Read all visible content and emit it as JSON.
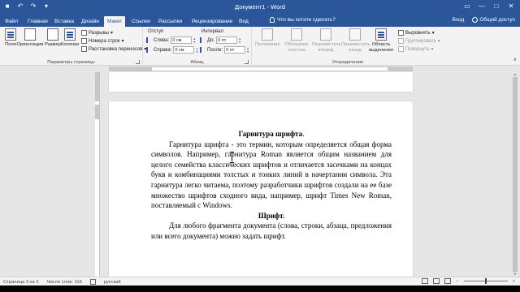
{
  "titlebar": {
    "doc_title": "Документ1 - Word",
    "qat": [
      "save-icon",
      "undo-icon",
      "redo-icon",
      "customize-icon"
    ],
    "controls": [
      "ribbon-display-icon",
      "minimize-icon",
      "maximize-icon",
      "close-icon"
    ]
  },
  "tabs": [
    {
      "label": "Файл",
      "active": false
    },
    {
      "label": "Главная",
      "active": false
    },
    {
      "label": "Вставка",
      "active": false
    },
    {
      "label": "Дизайн",
      "active": false
    },
    {
      "label": "Макет",
      "active": true
    },
    {
      "label": "Ссылки",
      "active": false
    },
    {
      "label": "Рассылки",
      "active": false
    },
    {
      "label": "Рецензирование",
      "active": false
    },
    {
      "label": "Вид",
      "active": false
    }
  ],
  "tell_me": "Что вы хотите сделать?",
  "user": {
    "signin": "Вход",
    "share": "Общий доступ"
  },
  "ribbon": {
    "page_setup": {
      "label": "Параметры страницы",
      "margins": "Поля",
      "orientation": "Ориентация",
      "size": "Размер",
      "columns": "Колонки",
      "breaks": "Разрывы",
      "line_numbers": "Номера строк",
      "hyphenation": "Расстановка переносов"
    },
    "paragraph": {
      "label": "Абзац",
      "indent_title": "Отступ",
      "spacing_title": "Интервал",
      "left_label": "Слева:",
      "left_value": "0 см",
      "right_label": "Справа:",
      "right_value": "0 см",
      "before_label": "До:",
      "before_value": "0 пт",
      "after_label": "После:",
      "after_value": "0 пт"
    },
    "arrange": {
      "label": "Упорядочение",
      "position": "Положение",
      "wrap_text": "Обтекание текстом",
      "bring_forward": "Переместить вперед",
      "send_backward": "Переместить назад",
      "selection_pane": "Область выделения",
      "align": "Выровнять",
      "group": "Группировать",
      "rotate": "Повернуть"
    }
  },
  "document": {
    "heading1_bold": "Гарнитура шрифта",
    "heading1_suffix": ".",
    "paragraph1": "Гарнитура шрифта - это термин, которым определяется общая форма символов. Например, гарнитура Roman является общим названием для целого семейства классических шрифтов и отличается засечками на концах букв и комбинациями толстых и тонких линий в начертании символа. Эта гарнитура легко читаема, поэтому разработчики шрифтов создали на ее базе множество шрифтов сходного вида, например, шрифт Times New Roman, поставляемый с Windows.",
    "heading2": "Шрифт.",
    "paragraph2": "Для любого фрагмента документа (слова, строки, абзаца, предложения или всего документа) можно задать шрифт."
  },
  "statusbar": {
    "page": "Страница 3 из 3",
    "words": "Число слов: 116",
    "language": "русский"
  },
  "colors": {
    "accent": "#2b579a",
    "ribbon_bg": "#f3f3f3",
    "workspace": "#e6e6e6"
  }
}
